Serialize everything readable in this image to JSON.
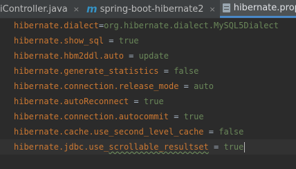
{
  "tabs": [
    {
      "label": "iController.java",
      "icon": "none",
      "active": false
    },
    {
      "label": "spring-boot-hibernate2",
      "icon": "maven-m-icon",
      "active": false
    },
    {
      "label": "hibernate.propert",
      "icon": "properties-file-icon",
      "active": true
    }
  ],
  "tab_close_glyph": "×",
  "maven_glyph": "m",
  "lines": [
    {
      "key": "hibernate.dialect",
      "sep": "=",
      "value": "org.hibernate.dialect.MySQL5Dialect"
    },
    {
      "key": "hibernate.show_sql",
      "sep": " = ",
      "value": "true"
    },
    {
      "key": "hibernate.hbm2ddl.auto",
      "sep": " = ",
      "value": "update"
    },
    {
      "key": "hibernate.generate_statistics",
      "sep": " = ",
      "value": "false"
    },
    {
      "key": "hibernate.connection.release_mode",
      "sep": " = ",
      "value": "auto"
    },
    {
      "key": "hibernate.autoReconnect",
      "sep": " = ",
      "value": "true"
    },
    {
      "key": "hibernate.connection.autocommit",
      "sep": " = ",
      "value": "true"
    },
    {
      "key": "hibernate.cache.use_second_level_cache",
      "sep": " = ",
      "value": "false"
    },
    {
      "key_prefix": "hibernate.jdbc.use_",
      "key_squiggle": "scrollable_resultset",
      "sep": " = ",
      "value": "true"
    }
  ],
  "colors": {
    "editor_bg": "#2b2b2b",
    "key": "#cc7832",
    "value": "#6a8759",
    "operator": "#a9b7c6",
    "active_tab_underline": "#4a88c7"
  }
}
